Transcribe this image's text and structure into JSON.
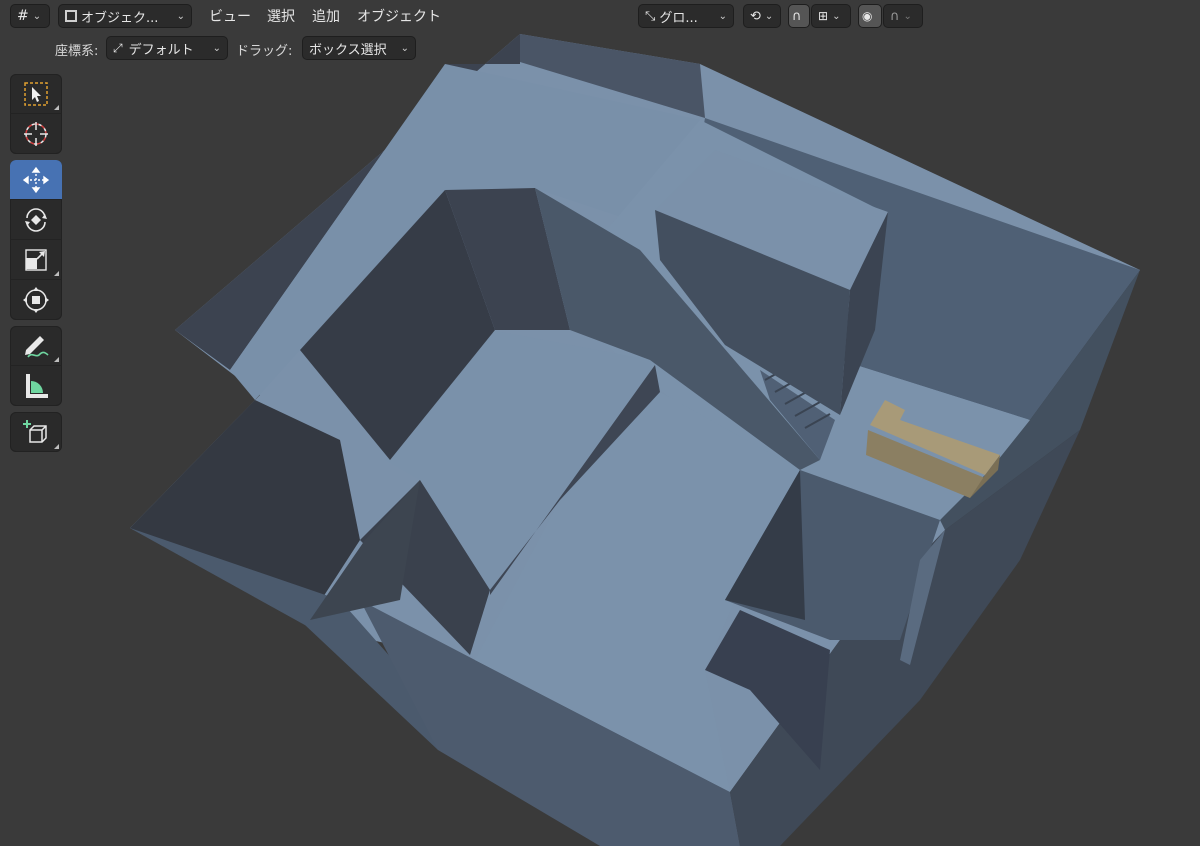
{
  "header": {
    "select_mode_label": "オブジェク...",
    "menus": [
      "ビュー",
      "選択",
      "追加",
      "オブジェクト"
    ],
    "orientation_label": "グロ..."
  },
  "tool_settings": {
    "coord_label": "座標系:",
    "coord_value": "デフォルト",
    "drag_label": "ドラッグ:",
    "drag_value": "ボックス選択"
  },
  "toolbar": {
    "tools": [
      {
        "name": "select-box-tool",
        "icon": "select-box-icon",
        "active": false
      },
      {
        "name": "cursor-tool",
        "icon": "cursor-icon",
        "active": false
      },
      {
        "name": "move-tool",
        "icon": "move-icon",
        "active": true
      },
      {
        "name": "rotate-tool",
        "icon": "rotate-icon",
        "active": false
      },
      {
        "name": "scale-tool",
        "icon": "scale-icon",
        "active": false
      },
      {
        "name": "transform-tool",
        "icon": "transform-icon",
        "active": false
      },
      {
        "name": "annotate-tool",
        "icon": "annotate-pencil-icon",
        "active": false
      },
      {
        "name": "measure-tool",
        "icon": "measure-ruler-icon",
        "active": false
      },
      {
        "name": "add-cube-tool",
        "icon": "add-cube-icon",
        "active": false
      }
    ]
  },
  "viewport": {
    "background_color": "#3a3a3a",
    "mesh_color": "#5d7089",
    "selected_object_color": "#a89a78",
    "active_tool_color": "#4772b3"
  }
}
